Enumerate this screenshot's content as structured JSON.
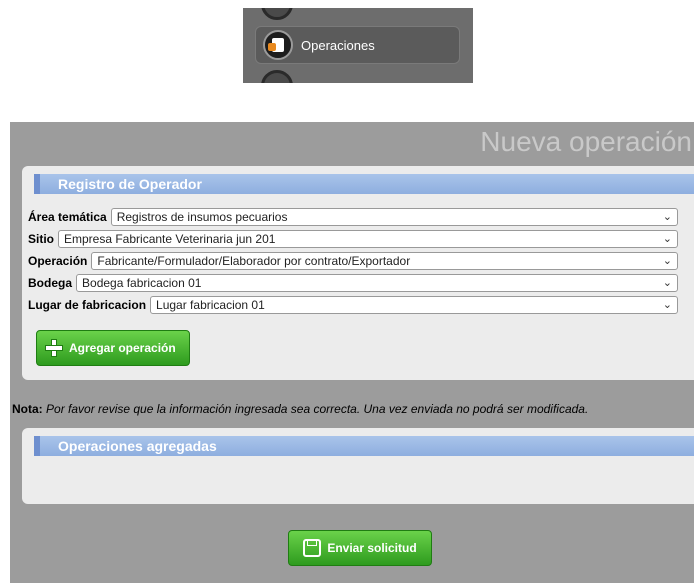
{
  "menu": {
    "item_label": "Operaciones",
    "item_icon": "operations-doc-icon"
  },
  "panel": {
    "title": "Nueva operación"
  },
  "registro": {
    "header": "Registro de Operador",
    "fields": [
      {
        "label": "Área temática",
        "value": "Registros de insumos pecuarios"
      },
      {
        "label": "Sitio",
        "value": "Empresa Fabricante Veterinaria jun 201"
      },
      {
        "label": "Operación",
        "value": "Fabricante/Formulador/Elaborador por contrato/Exportador"
      },
      {
        "label": "Bodega",
        "value": "Bodega fabricacion 01"
      },
      {
        "label": "Lugar de fabricacion",
        "value": "Lugar fabricacion 01"
      }
    ],
    "add_button": "Agregar operación"
  },
  "note": {
    "prefix": "Nota:",
    "text": "Por favor revise que la información ingresada sea correcta. Una vez enviada no podrá ser modificada."
  },
  "agregadas": {
    "header": "Operaciones agregadas"
  },
  "submit": {
    "label": "Enviar solicitud"
  },
  "colors": {
    "panel_bg": "#9c9c9c",
    "section_header": "#8eaedf",
    "button_green": "#2e9b1e"
  }
}
